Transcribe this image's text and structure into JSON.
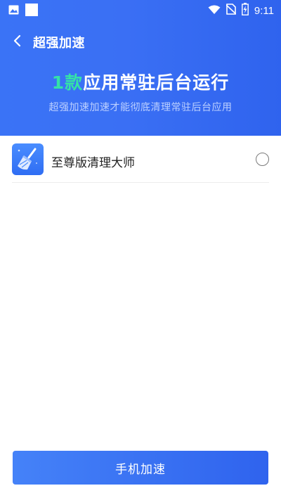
{
  "status_bar": {
    "time": "9:11",
    "icons": [
      "image-notification-icon",
      "square-notification-icon",
      "wifi-icon",
      "no-sim-icon",
      "battery-charging-icon"
    ]
  },
  "header": {
    "title": "超强加速",
    "headline_count": "1款",
    "headline_text": "应用常驻后台运行",
    "subtitle": "超强加速加速才能彻底清理常驻后台应用"
  },
  "apps": [
    {
      "name": "至尊版清理大师",
      "icon": "broom-icon",
      "selected": false
    }
  ],
  "actions": {
    "accelerate_label": "手机加速"
  },
  "colors": {
    "header_blue": "#3a6ff4",
    "count_green": "#34e3a7",
    "button_blue": "#3a6ff4"
  }
}
